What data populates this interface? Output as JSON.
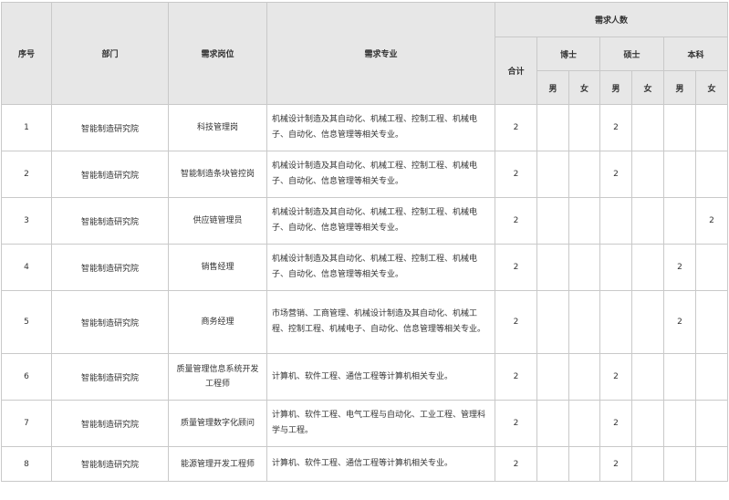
{
  "headers": {
    "seq": "序号",
    "dept": "部门",
    "position": "需求岗位",
    "major": "需求专业",
    "demand": "需求人数",
    "total": "合计",
    "phd": "博士",
    "master": "硕士",
    "bachelor": "本科",
    "male": "男",
    "female": "女"
  },
  "rows": [
    {
      "seq": "1",
      "dept": "智能制造研究院",
      "position": "科技管理岗",
      "major": "机械设计制造及其自动化、机械工程、控制工程、机械电子、自动化、信息管理等相关专业。",
      "total": "2",
      "phd_m": "",
      "phd_f": "",
      "master_m": "2",
      "master_f": "",
      "bach_m": "",
      "bach_f": ""
    },
    {
      "seq": "2",
      "dept": "智能制造研究院",
      "position": "智能制造条块管控岗",
      "major": "机械设计制造及其自动化、机械工程、控制工程、机械电子、自动化、信息管理等相关专业。",
      "total": "2",
      "phd_m": "",
      "phd_f": "",
      "master_m": "2",
      "master_f": "",
      "bach_m": "",
      "bach_f": ""
    },
    {
      "seq": "3",
      "dept": "智能制造研究院",
      "position": "供应链管理员",
      "major": "机械设计制造及其自动化、机械工程、控制工程、机械电子、自动化、信息管理等相关专业。",
      "total": "2",
      "phd_m": "",
      "phd_f": "",
      "master_m": "",
      "master_f": "",
      "bach_m": "",
      "bach_f": "2"
    },
    {
      "seq": "4",
      "dept": "智能制造研究院",
      "position": "销售经理",
      "major": "机械设计制造及其自动化、机械工程、控制工程、机械电子、自动化、信息管理等相关专业。",
      "total": "2",
      "phd_m": "",
      "phd_f": "",
      "master_m": "",
      "master_f": "",
      "bach_m": "2",
      "bach_f": ""
    },
    {
      "seq": "5",
      "dept": "智能制造研究院",
      "position": "商务经理",
      "major": "市场营销、工商管理、机械设计制造及其自动化、机械工程、控制工程、机械电子、自动化、信息管理等相关专业。",
      "total": "2",
      "phd_m": "",
      "phd_f": "",
      "master_m": "",
      "master_f": "",
      "bach_m": "2",
      "bach_f": ""
    },
    {
      "seq": "6",
      "dept": "智能制造研究院",
      "position": "质量管理信息系统开发工程师",
      "major": "计算机、软件工程、通信工程等计算机相关专业。",
      "total": "2",
      "phd_m": "",
      "phd_f": "",
      "master_m": "2",
      "master_f": "",
      "bach_m": "",
      "bach_f": ""
    },
    {
      "seq": "7",
      "dept": "智能制造研究院",
      "position": "质量管理数字化顾问",
      "major": "计算机、软件工程、电气工程与自动化、工业工程、管理科学与工程。",
      "total": "2",
      "phd_m": "",
      "phd_f": "",
      "master_m": "2",
      "master_f": "",
      "bach_m": "",
      "bach_f": ""
    },
    {
      "seq": "8",
      "dept": "智能制造研究院",
      "position": "能源管理开发工程师",
      "major": "计算机、软件工程、通信工程等计算机相关专业。",
      "total": "2",
      "phd_m": "",
      "phd_f": "",
      "master_m": "2",
      "master_f": "",
      "bach_m": "",
      "bach_f": ""
    }
  ]
}
